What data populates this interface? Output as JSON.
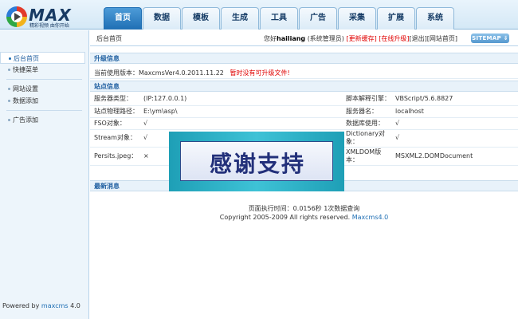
{
  "header": {
    "logo_text": "MAX",
    "logo_slogan": "精彩视频 由你开始",
    "nav_tabs": [
      "首页",
      "数据",
      "模板",
      "生成",
      "工具",
      "广告",
      "采集",
      "扩展",
      "系统"
    ],
    "active_tab": "首页"
  },
  "sidebar": {
    "items": [
      {
        "label": "后台首页",
        "active": true
      },
      {
        "label": "快捷菜单"
      },
      {
        "label": "网站设置"
      },
      {
        "label": "数据添加"
      },
      {
        "label": "广告添加"
      }
    ],
    "powered_by_prefix": "Powered by ",
    "powered_by_brand": "maxcms",
    "powered_by_version": " 4.0"
  },
  "topline": {
    "breadcrumb": "后台首页",
    "greeting_prefix": "您好",
    "username": "hailiang",
    "role": "(系统管理员)",
    "update_cache": "[更新缓存]",
    "online_upgrade": "[在线升级]",
    "logout": "[退出]",
    "site_home": "[网站首页]",
    "sitemap_label": "SITEMAP ⇓"
  },
  "upgrade": {
    "heading": "升级信息",
    "current_version_label": "当前使用版本：",
    "current_version": "MaxcmsVer4.0.2011.11.22",
    "upgrade_status": "暂时没有可升级文件!"
  },
  "site_info": {
    "heading": "站点信息",
    "rows": [
      {
        "label1": "服务器类型：",
        "value1": "(IP:127.0.0.1)",
        "label2": "脚本解释引擎：",
        "value2": "VBScript/5.6.8827"
      },
      {
        "label1": "站点物理路径：",
        "value1": "E:\\ym\\asp\\",
        "label2": "服务器名：",
        "value2": "localhost"
      },
      {
        "label1": "FSO对象：",
        "value1": "√",
        "label2": "数据库使用：",
        "value2": "√"
      },
      {
        "label1": "Stream对象：",
        "value1": "√",
        "label2": "Dictionary对象：",
        "value2": "√"
      },
      {
        "label1": "Persits.jpeg：",
        "value1": "×",
        "label2": "XMLDOM版本：",
        "value2": "MSXML2.DOMDocument"
      }
    ]
  },
  "news": {
    "heading": "最新消息"
  },
  "footer": {
    "exec_time": "页面执行时间：0.0156秒  1次数据查询",
    "copyright": "Copyright 2005-2009 All rights reserved. ",
    "brand": "Maxcms4.0"
  },
  "banner": {
    "text": "感谢支持"
  },
  "colors": {
    "accent": "#1f6fb4",
    "warning": "#e00000",
    "banner_bg": "#1e9fb6"
  }
}
